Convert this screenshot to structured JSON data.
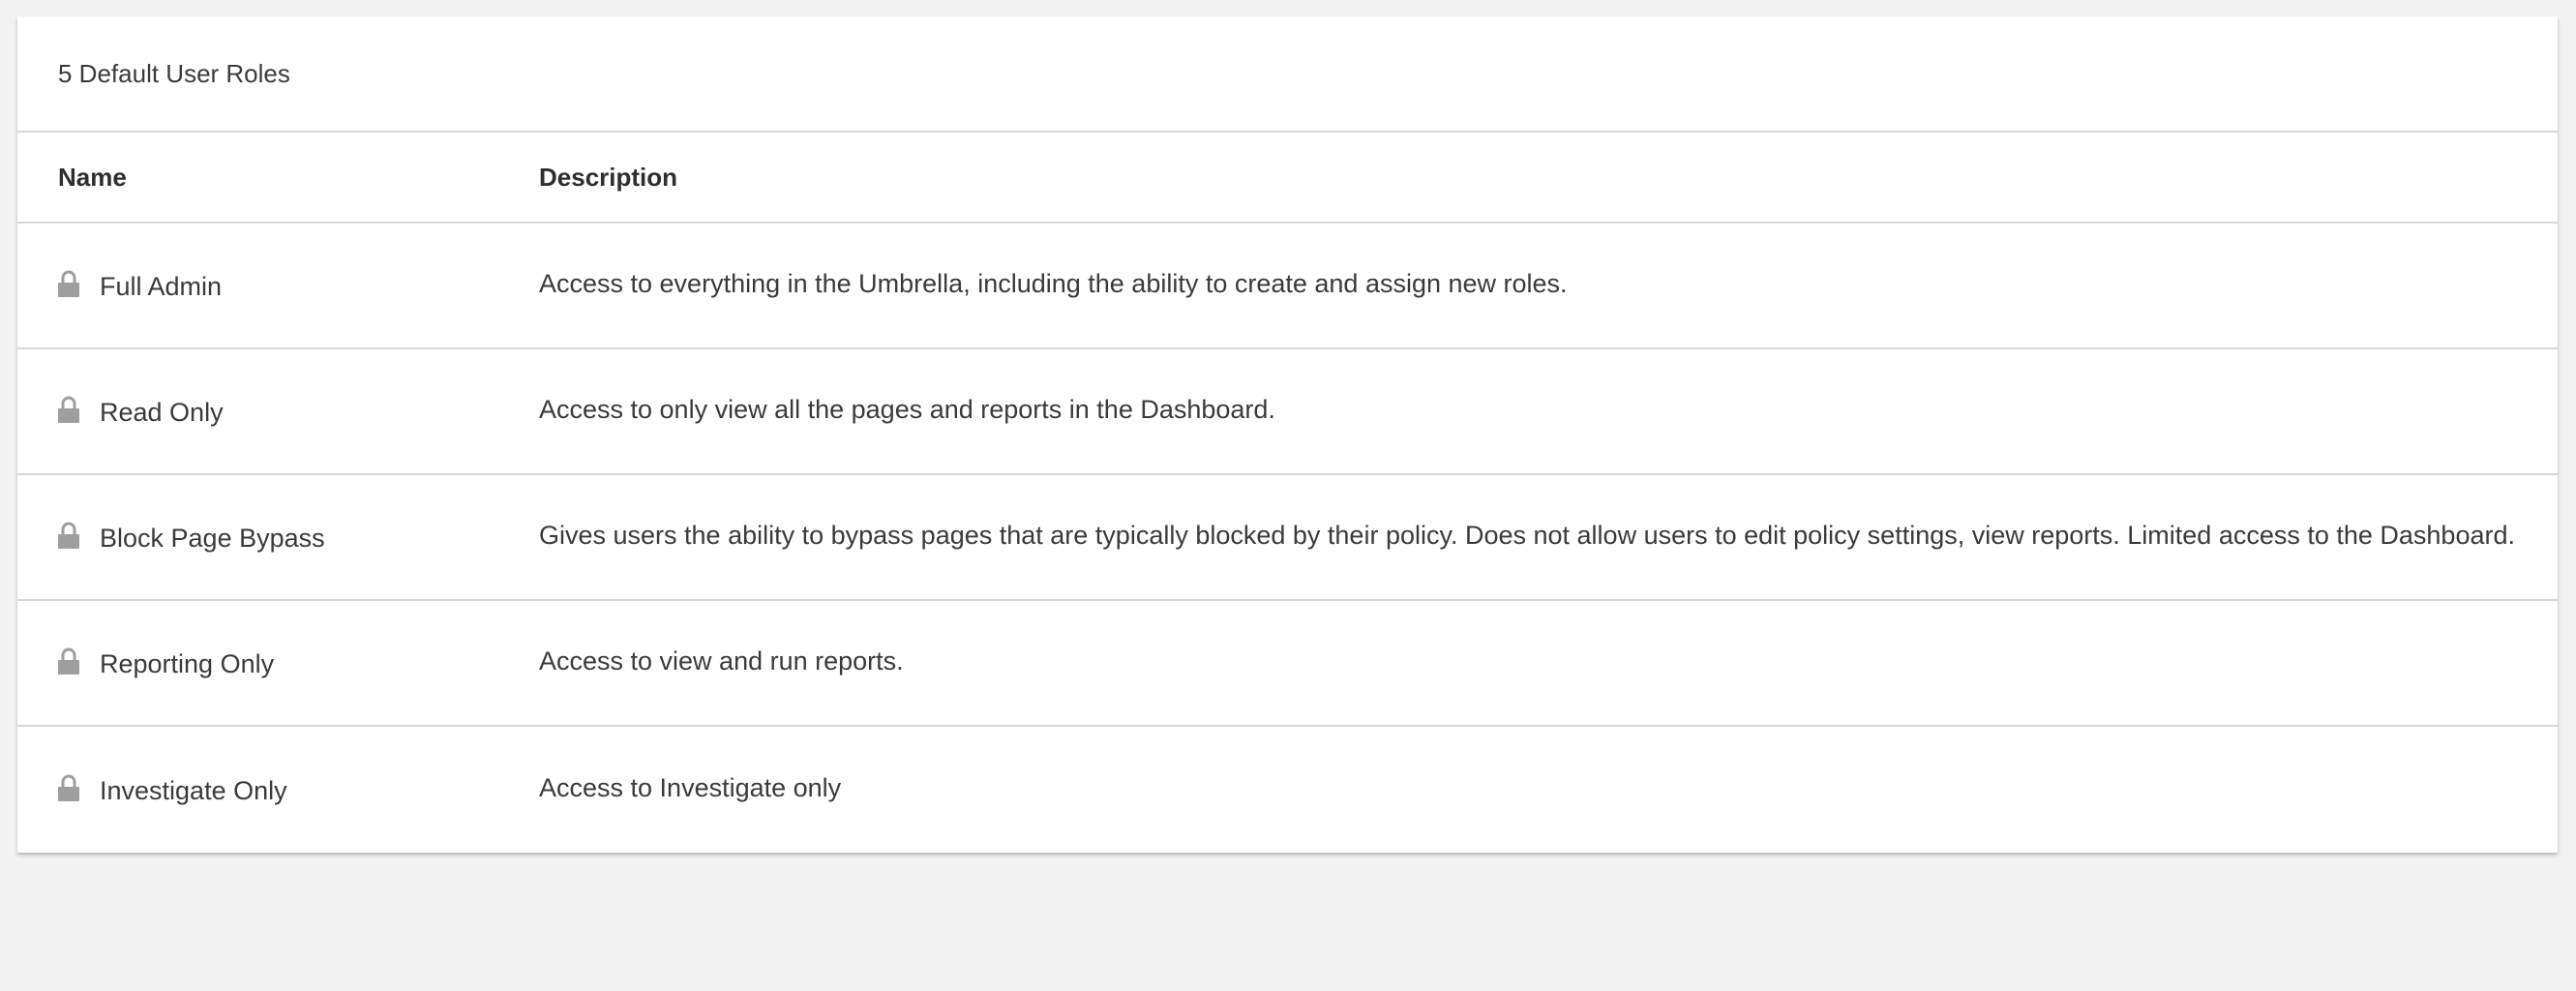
{
  "card": {
    "title": "5 Default User Roles"
  },
  "table": {
    "headers": {
      "name": "Name",
      "description": "Description"
    },
    "rows": [
      {
        "name": "Full Admin",
        "description": "Access to everything in the Umbrella, including the ability to create and assign new roles.",
        "icon": "lock-icon"
      },
      {
        "name": "Read Only",
        "description": "Access to only view all the pages and reports in the Dashboard.",
        "icon": "lock-icon"
      },
      {
        "name": "Block Page Bypass",
        "description": "Gives users the ability to bypass pages that are typically blocked by their policy. Does not allow users to edit policy settings, view reports. Limited access to the Dashboard.",
        "icon": "lock-icon"
      },
      {
        "name": "Reporting Only",
        "description": "Access to view and run reports.",
        "icon": "lock-icon"
      },
      {
        "name": "Investigate Only",
        "description": "Access to Investigate only",
        "icon": "lock-icon"
      }
    ]
  },
  "colors": {
    "background": "#f2f2f2",
    "card": "#ffffff",
    "divider": "#d6d6d6",
    "text": "#3a3a3a",
    "icon": "#9e9e9e"
  }
}
